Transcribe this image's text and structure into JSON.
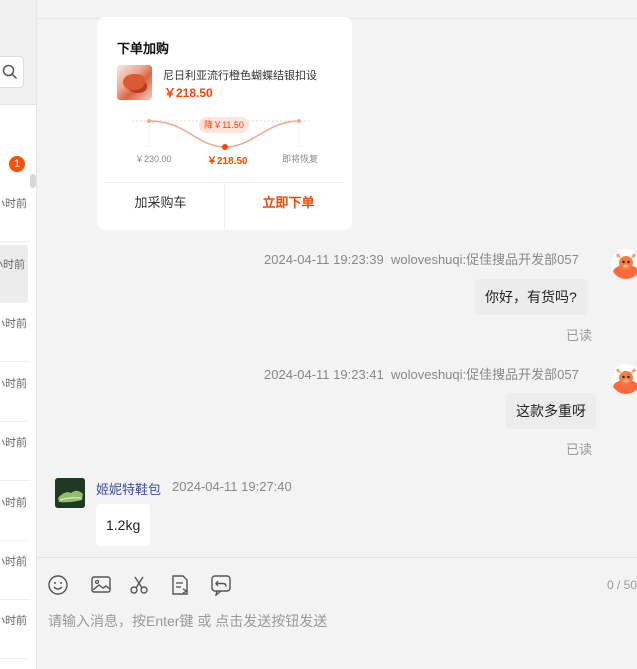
{
  "sidebar": {
    "badge_count": "1",
    "items": [
      {
        "time": "小时前"
      },
      {
        "time": "小时前"
      },
      {
        "time": "小时前"
      },
      {
        "time": "小时前"
      },
      {
        "time": "小时前"
      },
      {
        "time": "小时前"
      },
      {
        "time": "小时前"
      },
      {
        "time": "小时前"
      }
    ]
  },
  "order_card": {
    "title": "下单加购",
    "product_name": "尼日利亚流行橙色蝴蝶结银扣设",
    "price": "￥218.50",
    "price_chart": {
      "left_label": "￥230.00",
      "mid_label": "￥218.50",
      "right_label": "即将恢复",
      "drop_label": "降￥11.50"
    },
    "add_cart_label": "加采购车",
    "buy_now_label": "立即下单"
  },
  "messages": [
    {
      "time": "2024-04-11 19:23:39",
      "sender": "woloveshuqi:促佳搜品开发部057",
      "text": "你好，有货吗?",
      "status": "已读"
    },
    {
      "time": "2024-04-11 19:23:41",
      "sender": "woloveshuqi:促佳搜品开发部057",
      "text": "这款多重呀",
      "status": "已读"
    },
    {
      "time": "2024-04-11 19:27:40",
      "sender": "姬妮特鞋包",
      "text": "1.2kg"
    }
  ],
  "composer": {
    "counter": "0 / 50",
    "placeholder": "请输入消息，按Enter键 或 点击发送按钮发送",
    "tools": [
      "emoji-icon",
      "image-icon",
      "scissors-icon",
      "document-icon",
      "share-icon"
    ]
  },
  "colors": {
    "accent": "#ff4400",
    "badge": "#ff5000",
    "sender_link": "#3a4bb0"
  }
}
